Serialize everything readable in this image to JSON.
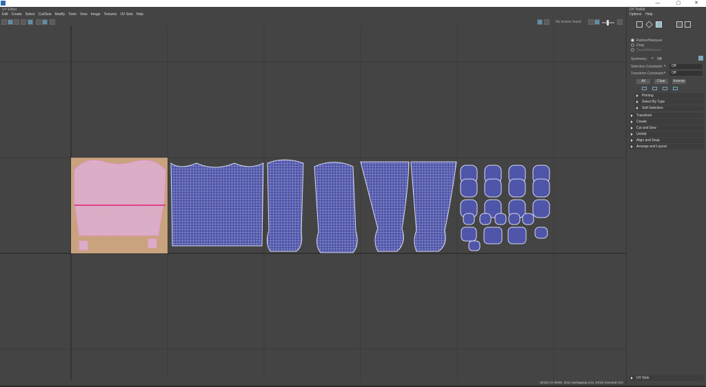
{
  "window": {
    "close_glyph": "✕",
    "maximize_glyph": "▢",
    "minimize_glyph": "—"
  },
  "uv_editor": {
    "title": "UV Editor",
    "menus": [
      "Edit",
      "Create",
      "Select",
      "Cut/Sew",
      "Modify",
      "Tools",
      "View",
      "Image",
      "Textures",
      "UV Sets",
      "Help"
    ],
    "no_texture_label": "No texture found"
  },
  "toolkit": {
    "title": "UV Toolkit",
    "menus": [
      "Options",
      "Help"
    ],
    "selection_modes": [
      "Rubber/Marquee",
      "Drag",
      "Tweak/Marquee"
    ],
    "symmetry": {
      "label": "Symmetry:",
      "value": "Off"
    },
    "selection_constraint": {
      "label": "Selection Constraint:",
      "value": "Off"
    },
    "transform_constraint": {
      "label": "Transform Constraint:",
      "value": "Off"
    },
    "buttons": [
      "All",
      "Clear",
      "Inverse"
    ],
    "sub_sections": [
      "Pinning",
      "Select By Type",
      "Soft Selection"
    ],
    "sections": [
      "Transform",
      "Create",
      "Cut and Sew",
      "Unfold",
      "Align and Snap",
      "Arrange and Layout"
    ],
    "uv_sets_label": "UV Sets"
  },
  "status": {
    "message": "(8/33) UV shells, (0/4) overlapping UVs, (0/10) reversed UVs"
  },
  "colors": {
    "shell_fill": "#4f55a8",
    "shell_wire": "#d8dcf5",
    "selected_fill": "#c9a27e",
    "selected_wire": "#e89ad4",
    "grid": "#3a3a3a",
    "axis": "#222222",
    "toolbar_active": "#5f8fa8"
  },
  "icons": [
    "window-app-icon",
    "grid-toggle-icon",
    "checker-icon",
    "shade-uv-icon",
    "vertex-mode-icon",
    "edge-mode-icon",
    "face-mode-icon",
    "uv-shell-mode-icon",
    "symmetry-icon"
  ]
}
